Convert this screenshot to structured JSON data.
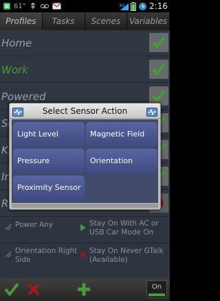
{
  "status_bar": {
    "temperature": "61°",
    "time": "2:16"
  },
  "tabs": [
    {
      "label": "Profiles",
      "active": true
    },
    {
      "label": "Tasks",
      "active": false
    },
    {
      "label": "Scenes",
      "active": false
    },
    {
      "label": "Variables",
      "active": false
    }
  ],
  "profiles": [
    {
      "name": "Home",
      "active": false
    },
    {
      "name": "Work",
      "active": true
    },
    {
      "name": "Powered",
      "active": false
    },
    {
      "name": "Sc",
      "active": false
    },
    {
      "name": "Kr",
      "active": false
    },
    {
      "name": "In",
      "active": false
    },
    {
      "name": "Ra",
      "active": false
    }
  ],
  "contexts": [
    {
      "label": "Power Any"
    },
    {
      "label": "Stay On With AC or USB Car Mode On"
    },
    {
      "label": "Orientation Right Side"
    },
    {
      "label": "Stay On Never GTalk (Available)"
    }
  ],
  "toolbar": {
    "toggle_label": "On"
  },
  "dialog": {
    "title": "Select Sensor Action",
    "options": [
      "Light Level",
      "Magnetic Field",
      "Pressure",
      "Orientation",
      "Proximity Sensor"
    ]
  },
  "colors": {
    "accent_green": "#5fd04a",
    "list_bg": "#3f4a59",
    "option_bg": "#4a5690"
  }
}
